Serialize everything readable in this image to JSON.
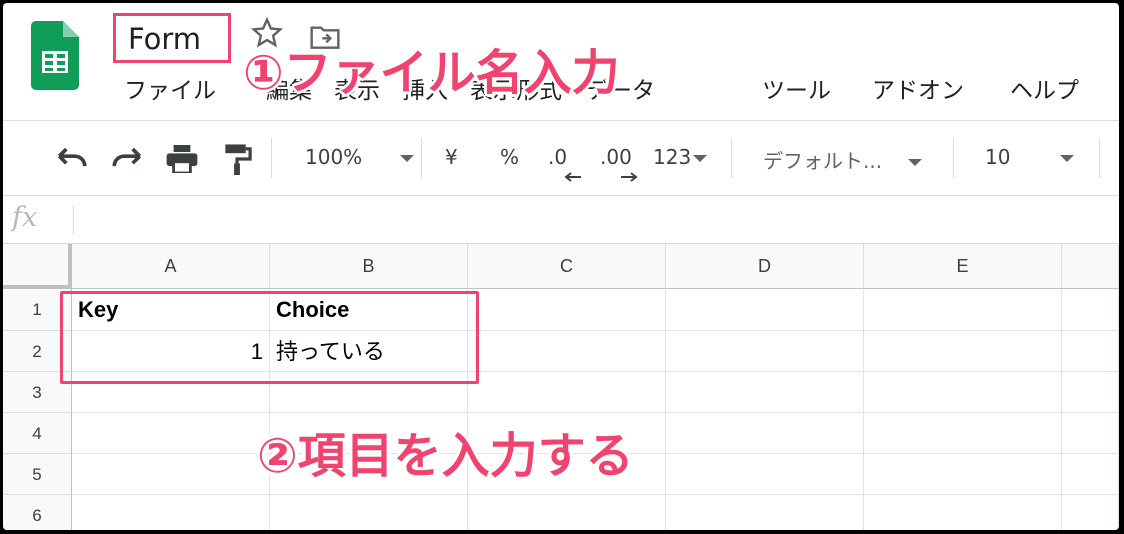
{
  "document": {
    "title": "Form"
  },
  "menu": [
    "ファイル",
    "編集",
    "表示",
    "挿入",
    "表示形式",
    "データ",
    "ツール",
    "アドオン",
    "ヘルプ"
  ],
  "toolbar": {
    "zoom": "100%",
    "currency": "¥",
    "percent": "%",
    "decrease_decimals": ".0",
    "increase_decimals": ".00",
    "more_formats": "123",
    "font": "デフォルト...",
    "font_size": "10"
  },
  "formula_bar": {
    "icon_label": "fx",
    "value": ""
  },
  "grid": {
    "columns": [
      "A",
      "B",
      "C",
      "D",
      "E"
    ],
    "rows": [
      "1",
      "2",
      "3",
      "4",
      "5",
      "6"
    ],
    "cells": {
      "A1": "Key",
      "B1": "Choice",
      "A2": "1",
      "B2": "持っている"
    }
  },
  "annotations": {
    "step1": "①ファイル名入力",
    "step2": "②項目を入力する",
    "accent_color": "#f0436e"
  }
}
